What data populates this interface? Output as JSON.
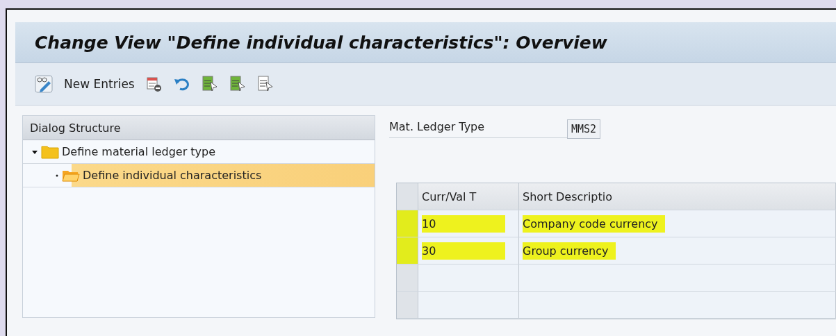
{
  "window": {
    "title": "Change View \"Define individual characteristics\": Overview"
  },
  "toolbar": {
    "new_entries": "New Entries"
  },
  "dialog_structure": {
    "title": "Dialog Structure",
    "items": [
      {
        "label": "Define material ledger type",
        "expanded": true,
        "selected": false,
        "children": [
          {
            "label": "Define individual characteristics",
            "selected": true
          }
        ]
      }
    ]
  },
  "header": {
    "label": "Mat. Ledger Type",
    "value": "MMS2"
  },
  "table": {
    "columns": [
      "Curr/Val T",
      "Short Descriptio"
    ],
    "rows": [
      {
        "cells": [
          "10",
          "Company code currency"
        ],
        "highlighted": true
      },
      {
        "cells": [
          "30",
          "Group currency"
        ],
        "highlighted": true
      },
      {
        "cells": [],
        "highlighted": false
      },
      {
        "cells": [],
        "highlighted": false
      }
    ]
  }
}
